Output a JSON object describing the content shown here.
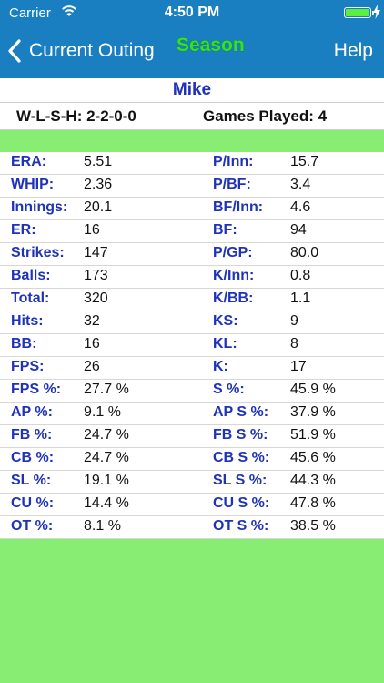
{
  "status": {
    "carrier": "Carrier",
    "time": "4:50 PM"
  },
  "nav": {
    "back_label": "Current Outing",
    "title": "Season",
    "help_label": "Help"
  },
  "player": {
    "name": "Mike",
    "record": "W-L-S-H: 2-2-0-0",
    "games_played": "Games Played: 4"
  },
  "stats": [
    {
      "l1": "ERA:",
      "v1": "5.51",
      "l2": "P/Inn:",
      "v2": "15.7"
    },
    {
      "l1": "WHIP:",
      "v1": "2.36",
      "l2": "P/BF:",
      "v2": "3.4"
    },
    {
      "l1": "Innings:",
      "v1": "20.1",
      "l2": "BF/Inn:",
      "v2": "4.6"
    },
    {
      "l1": "ER:",
      "v1": "16",
      "l2": "BF:",
      "v2": "94"
    },
    {
      "l1": "Strikes:",
      "v1": "147",
      "l2": "P/GP:",
      "v2": "80.0"
    },
    {
      "l1": "Balls:",
      "v1": "173",
      "l2": "K/Inn:",
      "v2": "0.8"
    },
    {
      "l1": "Total:",
      "v1": "320",
      "l2": "K/BB:",
      "v2": "1.1"
    },
    {
      "l1": "Hits:",
      "v1": "32",
      "l2": "KS:",
      "v2": "9"
    },
    {
      "l1": "BB:",
      "v1": "16",
      "l2": "KL:",
      "v2": "8"
    },
    {
      "l1": "FPS:",
      "v1": "26",
      "l2": "K:",
      "v2": "17"
    },
    {
      "l1": "FPS %:",
      "v1": "27.7 %",
      "l2": "S %:",
      "v2": "45.9 %"
    },
    {
      "l1": "AP %:",
      "v1": "9.1 %",
      "l2": "AP S %:",
      "v2": "37.9 %"
    },
    {
      "l1": "FB %:",
      "v1": "24.7 %",
      "l2": "FB S %:",
      "v2": "51.9 %"
    },
    {
      "l1": "CB %:",
      "v1": "24.7 %",
      "l2": "CB S %:",
      "v2": "45.6 %"
    },
    {
      "l1": "SL %:",
      "v1": "19.1 %",
      "l2": "SL S %:",
      "v2": "44.3 %"
    },
    {
      "l1": "CU %:",
      "v1": "14.4 %",
      "l2": "CU S %:",
      "v2": "47.8 %"
    },
    {
      "l1": "OT %:",
      "v1": "8.1 %",
      "l2": "OT S %:",
      "v2": "38.5 %"
    }
  ],
  "colors": {
    "nav_bar": "#1a7fc1",
    "title_green": "#35e21e",
    "band_green": "#87ed73",
    "label_blue": "#1f33b8"
  },
  "icons": [
    "wifi-icon",
    "battery-icon",
    "charging-icon",
    "chevron-left-icon"
  ]
}
